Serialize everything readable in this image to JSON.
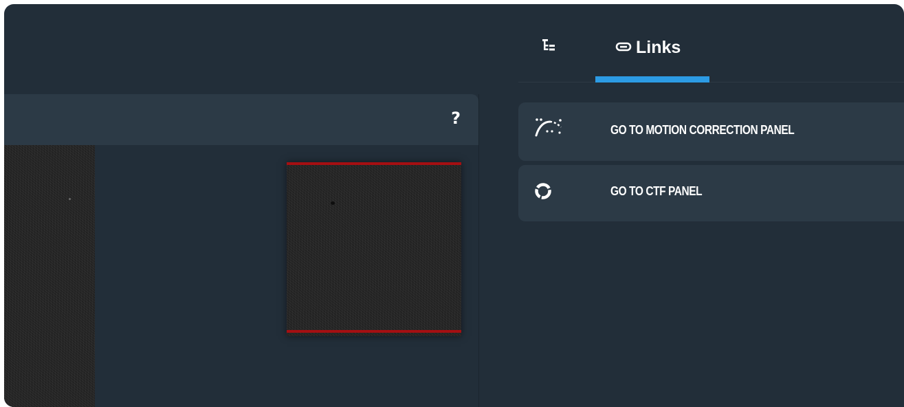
{
  "colors": {
    "window_bg": "#222e39",
    "panel_bg": "#2c3a46",
    "accent_tab_indicator": "#2c9be4",
    "thumbnail_border": "#a50f12",
    "text": "#ffffff"
  },
  "left_panel": {
    "help_label": "?",
    "micrograph_icon": "micrograph-image",
    "thumbnail_icon": "particle-thumbnail-image"
  },
  "sidebar": {
    "tabs": [
      {
        "icon": "tree-icon",
        "label": ""
      },
      {
        "icon": "link-icon",
        "label": "Links",
        "active": true
      }
    ],
    "links": [
      {
        "icon": "motion-correction-icon",
        "label": "GO TO MOTION CORRECTION PANEL"
      },
      {
        "icon": "ctf-icon",
        "label": "GO TO CTF PANEL"
      }
    ]
  }
}
